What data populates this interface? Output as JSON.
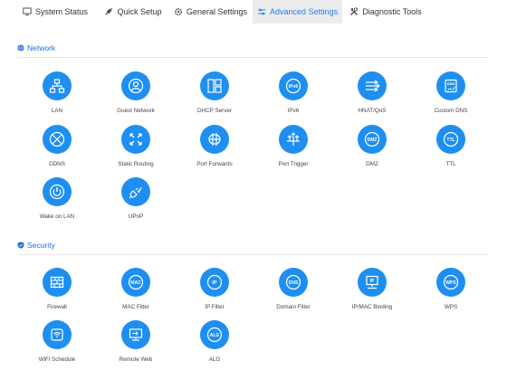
{
  "tabs": [
    {
      "label": "System Status",
      "icon": "monitor-icon",
      "active": false
    },
    {
      "label": "Quick Setup",
      "icon": "rocket-icon",
      "active": false
    },
    {
      "label": "General Settings",
      "icon": "gear-icon",
      "active": false
    },
    {
      "label": "Advanced Settings",
      "icon": "sliders-icon",
      "active": true
    },
    {
      "label": "Diagnostic Tools",
      "icon": "tools-icon",
      "active": false
    }
  ],
  "colors": {
    "accent": "#1e8ff0",
    "active_tab_bg": "#ececec",
    "section_title": "#1f6fd6"
  },
  "network": {
    "title": "Network",
    "items": [
      {
        "label": "LAN",
        "icon": "lan-icon"
      },
      {
        "label": "Guest Network",
        "icon": "guest-network-icon"
      },
      {
        "label": "DHCP Server",
        "icon": "dhcp-server-icon"
      },
      {
        "label": "IPv6",
        "icon": "ipv6-icon"
      },
      {
        "label": "HNAT/QoS",
        "icon": "hnat-qos-icon"
      },
      {
        "label": "Custom DNS",
        "icon": "custom-dns-icon"
      },
      {
        "label": "DDNS",
        "icon": "ddns-icon"
      },
      {
        "label": "Static Routing",
        "icon": "static-routing-icon"
      },
      {
        "label": "Port Forwards",
        "icon": "port-forwards-icon"
      },
      {
        "label": "Port Trigger",
        "icon": "port-trigger-icon"
      },
      {
        "label": "DMZ",
        "icon": "dmz-icon"
      },
      {
        "label": "TTL",
        "icon": "ttl-icon"
      },
      {
        "label": "Wake on LAN",
        "icon": "wake-on-lan-icon"
      },
      {
        "label": "UPnP",
        "icon": "upnp-icon"
      }
    ]
  },
  "security": {
    "title": "Security",
    "items": [
      {
        "label": "Firewall",
        "icon": "firewall-icon"
      },
      {
        "label": "MAC Filter",
        "icon": "mac-filter-icon"
      },
      {
        "label": "IP Filter",
        "icon": "ip-filter-icon"
      },
      {
        "label": "Domain Filter",
        "icon": "domain-filter-icon"
      },
      {
        "label": "IP/MAC Binding",
        "icon": "ip-mac-binding-icon"
      },
      {
        "label": "WPS",
        "icon": "wps-icon"
      },
      {
        "label": "WiFi Schedule",
        "icon": "wifi-schedule-icon"
      },
      {
        "label": "Remote Web",
        "icon": "remote-web-icon"
      },
      {
        "label": "ALG",
        "icon": "alg-icon"
      }
    ]
  },
  "badges": {
    "ipv6": "IPv6",
    "dns": "DNS",
    "dmz": "DMZ",
    "ttl": "TTL",
    "mac": "MAC",
    "ip": "IP",
    "domain": "DNS",
    "wps": "WPS",
    "alg": "ALG"
  }
}
